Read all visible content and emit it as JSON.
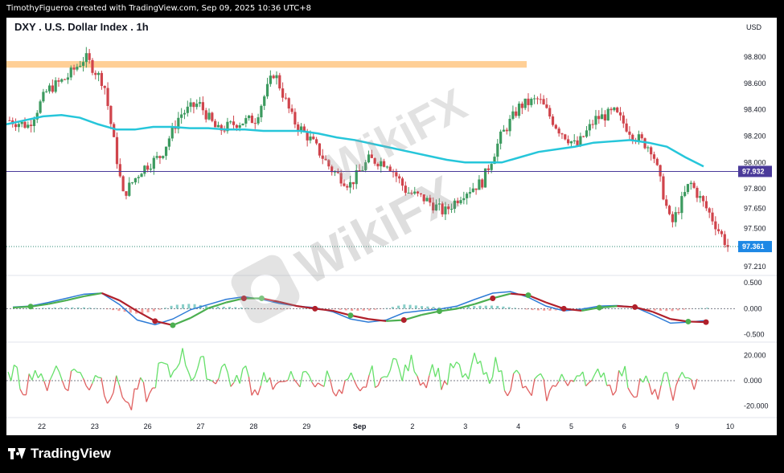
{
  "header": {
    "credit": "TimothyFigueroa created with TradingView.com, Sep 09, 2025 10:36 UTC+8"
  },
  "footer": {
    "brand": "TradingView"
  },
  "watermark": {
    "text": "WikiFX"
  },
  "colors": {
    "up": "#3c9a5f",
    "down": "#d0444c",
    "ma": "#26c6da",
    "resistance": "#ffcf96",
    "macd": "#2d7bd6",
    "signal": "#b0202b",
    "signal_up": "#4caf50",
    "rsi_up": "#66e06a",
    "rsi_down": "#e06060",
    "price_tag": "#1e88e5",
    "level_tag": "#4a3a9a"
  },
  "chart_data": [
    {
      "type": "candlestick",
      "title": "DXY . U.S. Dollar Index . 1h",
      "currency": "USD",
      "y_ticks": [
        98.8,
        98.6,
        98.4,
        98.2,
        98.0,
        97.8,
        97.65,
        97.5,
        97.21
      ],
      "y_tick_labels": [
        "98.800",
        "98.600",
        "98.400",
        "98.200",
        "98.000",
        "97.800",
        "97.650",
        "97.500",
        "97.210"
      ],
      "ylim": [
        97.16,
        98.99
      ],
      "x_ticks": [
        "22",
        "23",
        "26",
        "27",
        "28",
        "29",
        "Sep",
        "2",
        "3",
        "4",
        "5",
        "6",
        "9",
        "10"
      ],
      "resistance_zone": [
        98.72,
        98.77
      ],
      "level_line": {
        "value": 97.932,
        "label": "97.932"
      },
      "last_price": {
        "value": 97.361,
        "label": "97.361"
      },
      "moving_average": [
        98.29,
        98.32,
        98.35,
        98.36,
        98.34,
        98.29,
        98.25,
        98.25,
        98.27,
        98.27,
        98.26,
        98.26,
        98.25,
        98.25,
        98.24,
        98.24,
        98.24,
        98.22,
        98.19,
        98.17,
        98.14,
        98.11,
        98.08,
        98.05,
        98.02,
        98.0,
        98.0,
        98.0,
        98.04,
        98.08,
        98.1,
        98.12,
        98.15,
        98.16,
        98.17,
        98.15,
        98.12,
        98.04,
        97.97
      ],
      "closes": [
        98.32,
        98.28,
        98.55,
        98.64,
        98.8,
        98.6,
        97.75,
        97.95,
        98.05,
        98.36,
        98.45,
        98.24,
        98.3,
        98.33,
        98.69,
        98.32,
        98.16,
        97.95,
        97.83,
        98.02,
        98.0,
        97.78,
        97.72,
        97.62,
        97.77,
        97.85,
        98.2,
        98.43,
        98.48,
        98.26,
        98.12,
        98.33,
        98.38,
        98.21,
        98.1,
        97.52,
        97.85,
        97.62,
        97.36
      ],
      "ohlc_candles": 235
    },
    {
      "type": "line",
      "name": "macd-panel",
      "y_tick_labels": [
        "0.500",
        "0.000",
        "-0.500"
      ],
      "ylim": [
        -0.6,
        0.58
      ],
      "macd": [
        0.03,
        0.05,
        0.12,
        0.2,
        0.28,
        0.3,
        0.08,
        -0.22,
        -0.31,
        -0.2,
        -0.02,
        0.08,
        0.18,
        0.23,
        0.18,
        0.1,
        0.05,
        0.02,
        -0.06,
        -0.2,
        -0.26,
        -0.22,
        -0.08,
        -0.04,
        -0.01,
        0.05,
        0.18,
        0.3,
        0.33,
        0.22,
        0.05,
        -0.04,
        -0.01,
        0.05,
        0.06,
        0.03,
        -0.12,
        -0.28,
        -0.26,
        -0.23
      ],
      "signal": [
        0.02,
        0.04,
        0.09,
        0.16,
        0.24,
        0.3,
        0.16,
        -0.05,
        -0.24,
        -0.32,
        -0.18,
        0.01,
        0.12,
        0.2,
        0.2,
        0.13,
        0.05,
        0.0,
        -0.04,
        -0.13,
        -0.2,
        -0.24,
        -0.22,
        -0.12,
        -0.05,
        0.0,
        0.09,
        0.2,
        0.29,
        0.26,
        0.12,
        0.0,
        -0.04,
        0.02,
        0.05,
        0.03,
        -0.06,
        -0.2,
        -0.25,
        -0.26
      ],
      "cross_points_up": [
        1,
        9,
        14,
        19,
        24,
        29,
        33,
        38
      ],
      "cross_points_down": [
        8,
        13,
        17,
        22,
        27,
        31,
        35,
        39
      ]
    },
    {
      "type": "line",
      "name": "oscillator-panel",
      "y_tick_labels": [
        "20.000",
        "0.000",
        "-20.000"
      ],
      "ylim": [
        -28,
        28
      ],
      "threshold": 0
    }
  ]
}
